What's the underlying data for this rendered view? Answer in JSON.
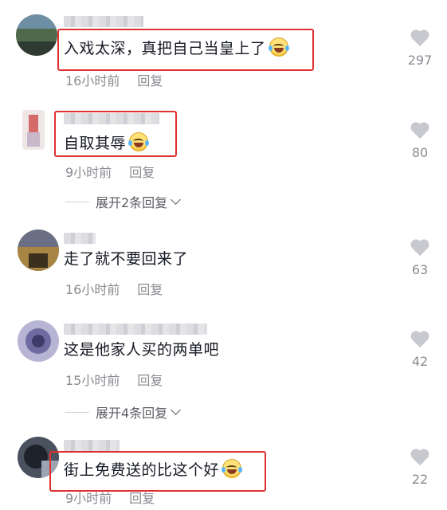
{
  "comments": [
    {
      "text": "入戏太深，真把自己当皇上了",
      "time": "16小时前",
      "reply": "回复",
      "likes": "297",
      "emoji": "laughing-tears-emoji",
      "highlighted": true
    },
    {
      "text": "自取其辱",
      "time": "9小时前",
      "reply": "回复",
      "likes": "80",
      "emoji": "laughing-tears-emoji",
      "highlighted": true
    },
    {
      "text": "走了就不要回来了",
      "time": "16小时前",
      "reply": "回复",
      "likes": "63",
      "emoji": "",
      "highlighted": false
    },
    {
      "text": "这是他家人买的两单吧",
      "time": "15小时前",
      "reply": "回复",
      "likes": "42",
      "emoji": "",
      "highlighted": false
    },
    {
      "text": "街上免费送的比这个好",
      "time": "9小时前",
      "reply": "回复",
      "likes": "22",
      "emoji": "laughing-tears-emoji",
      "highlighted": true
    }
  ],
  "expand": [
    {
      "label": "展开2条回复"
    },
    {
      "label": "展开4条回复"
    }
  ],
  "colors": {
    "highlight": "#e03131",
    "meta": "#8a8b91",
    "heart": "#c8c9ce"
  },
  "icons": {
    "like": "heart-icon",
    "expand": "chevron-down-icon"
  }
}
